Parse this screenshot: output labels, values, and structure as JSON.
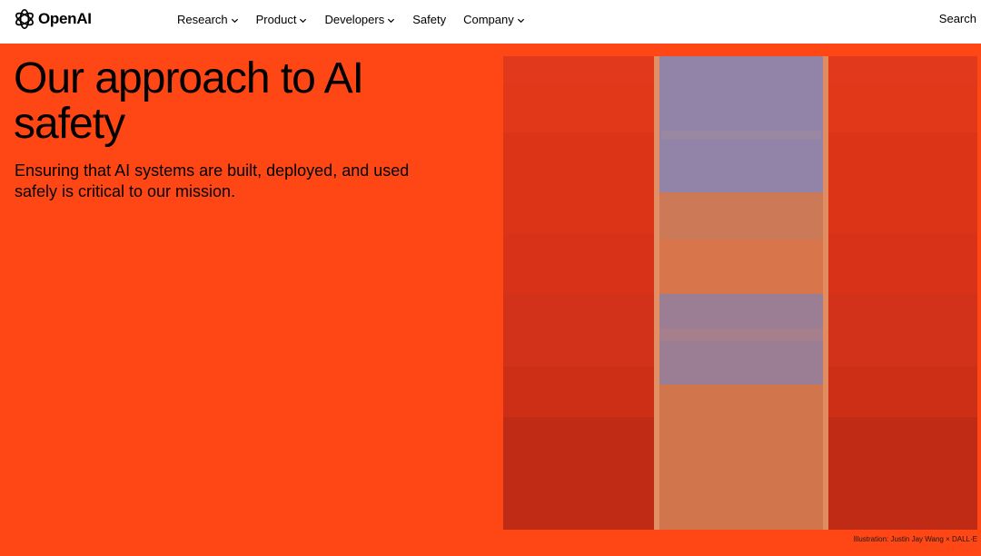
{
  "brand": {
    "name": "OpenAI",
    "icon": "openai-logo-icon"
  },
  "nav": {
    "items": [
      {
        "label": "Research",
        "has_dropdown": true
      },
      {
        "label": "Product",
        "has_dropdown": true
      },
      {
        "label": "Developers",
        "has_dropdown": true
      },
      {
        "label": "Safety",
        "has_dropdown": false
      },
      {
        "label": "Company",
        "has_dropdown": true
      }
    ],
    "search_label": "Search"
  },
  "hero": {
    "title": "Our approach to AI safety",
    "subtitle": "Ensuring that AI systems are built, deployed, and used safely is critical to our mission.",
    "caption": "Illustration: Justin Jay Wang × DALL·E"
  },
  "colors": {
    "hero_background": "#ff4716",
    "art_background": "#e2381a",
    "art_stripe_orange": "#d9754a",
    "art_stripe_lavender": "#8a86b4"
  }
}
